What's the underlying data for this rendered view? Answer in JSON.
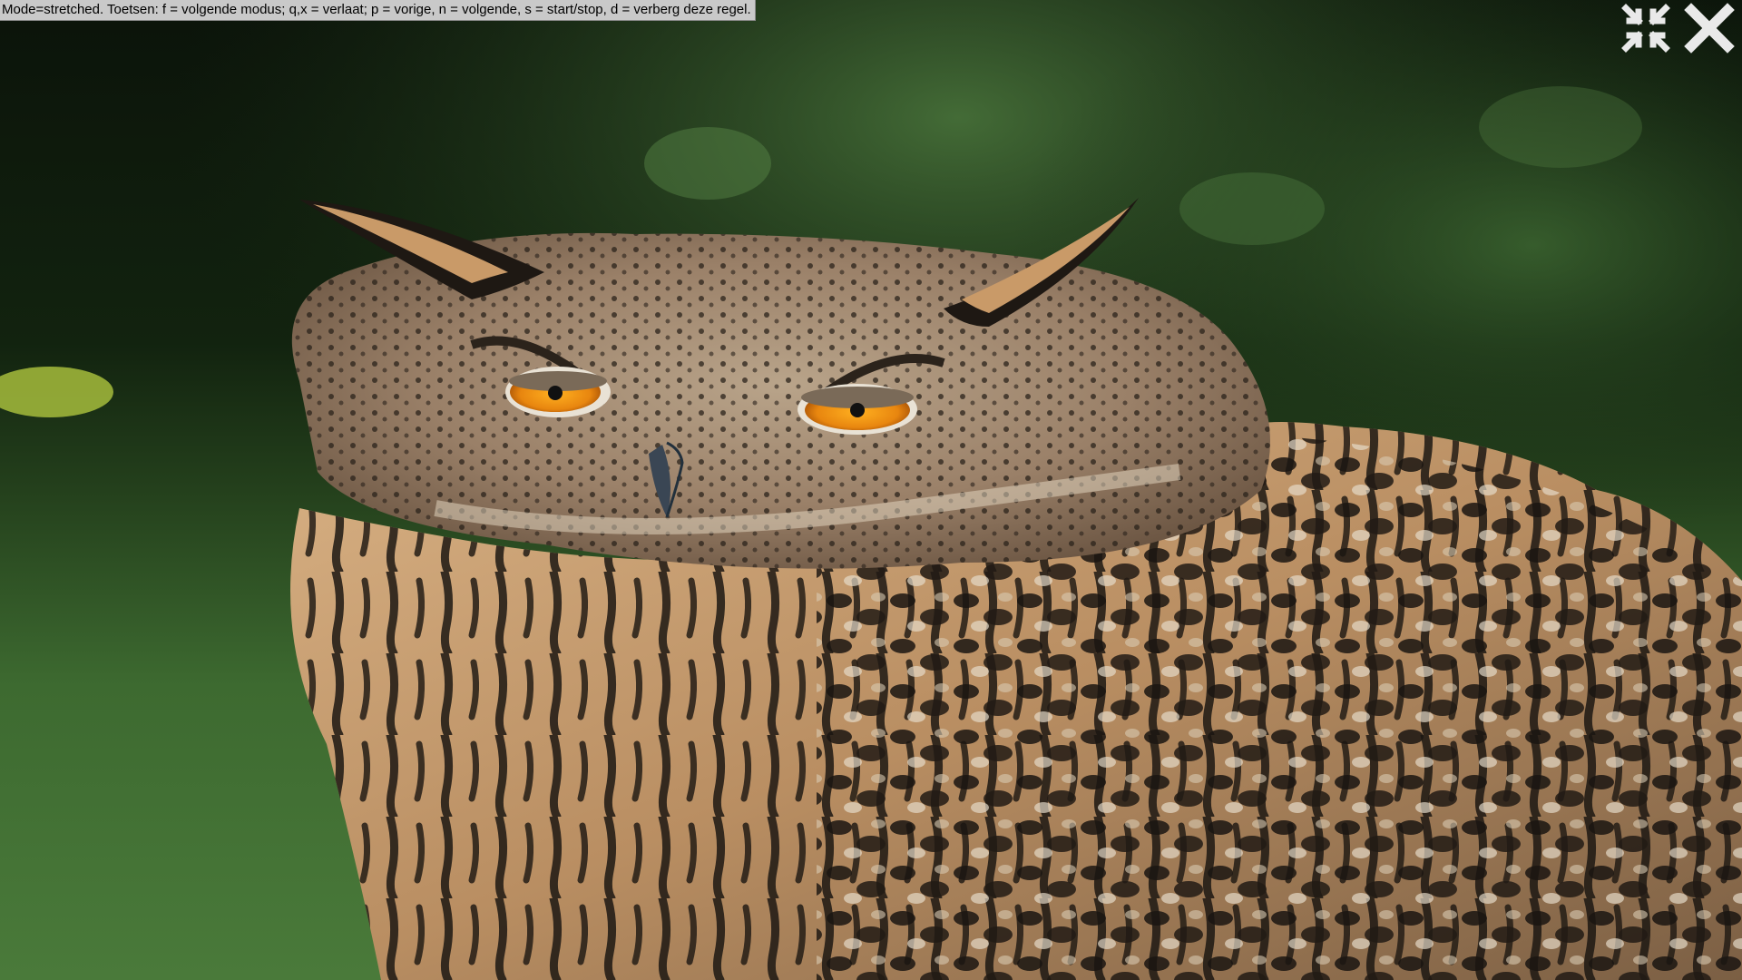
{
  "viewer": {
    "mode": "stretched",
    "status_text": "Mode=stretched. Toetsen: f = volgende modus; q,x = verlaat; p = vorige, n = volgende, s = start/stop, d = verberg deze regel.",
    "controls": {
      "exit_fullscreen_icon": "exit-fullscreen-icon",
      "close_icon": "close-icon"
    }
  },
  "photo": {
    "subject_icon": "owl-photo"
  },
  "colors": {
    "status_bg": "#c9c9c9",
    "status_text": "#000000",
    "control_icon": "#e9e9e9",
    "foliage_dark": "#0d160b",
    "grass": "#3f6e32",
    "feather_light": "#cfa274",
    "feather_dark": "#1f1a15",
    "eye_orange": "#e8860f"
  }
}
